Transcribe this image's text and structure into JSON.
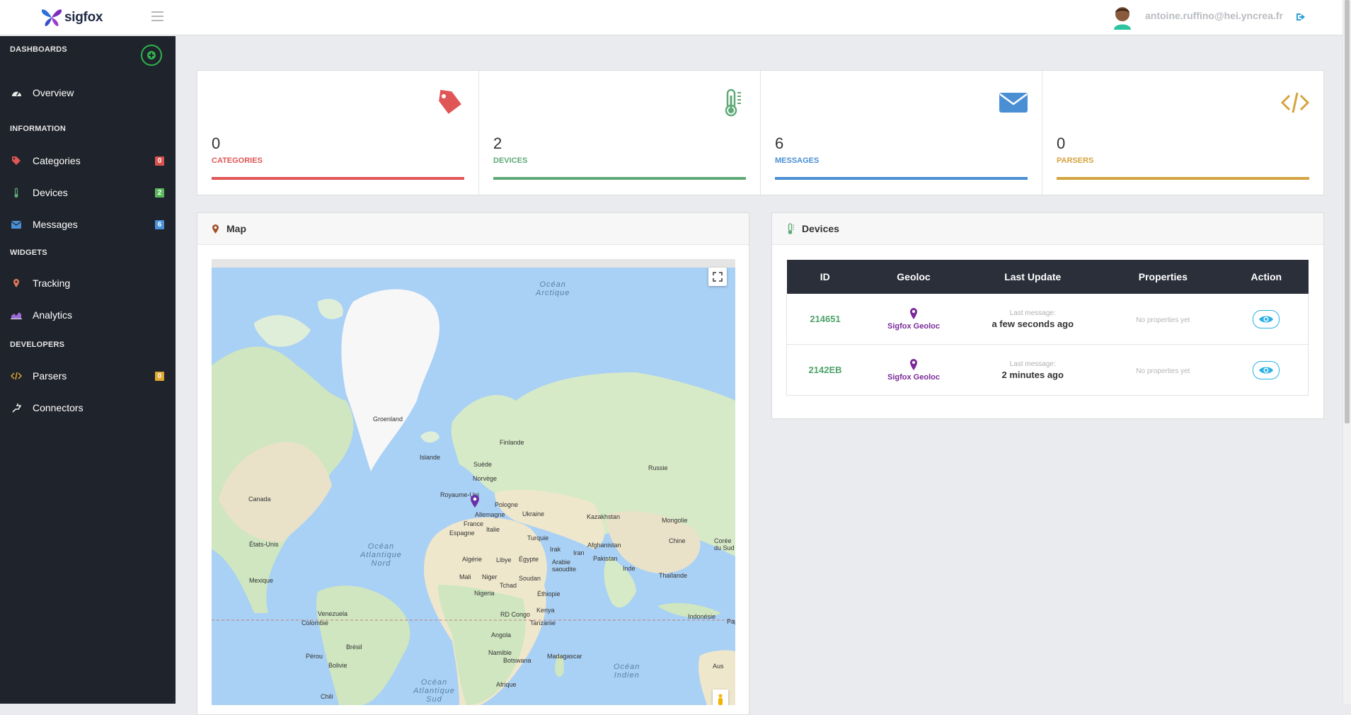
{
  "header": {
    "logo_text": "sigfox",
    "user_email": "antoine.ruffino@hei.yncrea.fr"
  },
  "sidebar": {
    "sections": {
      "dashboards": "DASHBOARDS",
      "information": "INFORMATION",
      "widgets": "WIDGETS",
      "developers": "DEVELOPERS"
    },
    "items": {
      "overview": {
        "label": "Overview",
        "icon": "dashboard-icon"
      },
      "categories": {
        "label": "Categories",
        "icon": "tag-icon",
        "badge": "0",
        "badge_color": "#d9534f"
      },
      "devices": {
        "label": "Devices",
        "icon": "thermometer-icon",
        "badge": "2",
        "badge_color": "#5cb85c"
      },
      "messages": {
        "label": "Messages",
        "icon": "envelope-icon",
        "badge": "6",
        "badge_color": "#4a90d9"
      },
      "tracking": {
        "label": "Tracking",
        "icon": "map-marker-icon"
      },
      "analytics": {
        "label": "Analytics",
        "icon": "area-chart-icon"
      },
      "parsers": {
        "label": "Parsers",
        "icon": "code-icon",
        "badge": "0",
        "badge_color": "#e0a82e"
      },
      "connectors": {
        "label": "Connectors",
        "icon": "plug-icon"
      }
    }
  },
  "stats": [
    {
      "value": "0",
      "label": "CATEGORIES",
      "color": "#e05656",
      "icon": "tag-icon"
    },
    {
      "value": "2",
      "label": "DEVICES",
      "color": "#5fa977",
      "icon": "thermometer-icon"
    },
    {
      "value": "6",
      "label": "MESSAGES",
      "color": "#4a8fd4",
      "icon": "envelope-icon"
    },
    {
      "value": "0",
      "label": "PARSERS",
      "color": "#d4a440",
      "icon": "code-icon"
    }
  ],
  "map_panel": {
    "title": "Map",
    "labels": {
      "ocean_arctic": "Océan\nArctique",
      "ocean_atl_nord": "Océan\nAtlantique\nNord",
      "ocean_atl_sud": "Océan\nAtlantique\nSud",
      "ocean_indien": "Océan\nIndien",
      "groenland": "Groenland",
      "islande": "Islande",
      "canada": "Canada",
      "etats_unis": "États-Unis",
      "mexique": "Mexique",
      "venezuela": "Venezuela",
      "colombie": "Colombie",
      "bresil": "Brésil",
      "perou": "Pérou",
      "bolivie": "Bolivie",
      "chili": "Chili",
      "norvege": "Norvège",
      "suede": "Suède",
      "finlande": "Finlande",
      "royaume_uni": "Royaume-Uni",
      "allemagne": "Allemagne",
      "pologne": "Pologne",
      "ukraine": "Ukraine",
      "france": "France",
      "espagne": "Espagne",
      "italie": "Italie",
      "turquie": "Turquie",
      "russie": "Russie",
      "kazakhstan": "Kazakhstan",
      "mongolie": "Mongolie",
      "chine": "Chine",
      "coree": "Corée\ndu Sud",
      "irak": "Irak",
      "iran": "Iran",
      "afghanistan": "Afghanistan",
      "pakistan": "Pakistan",
      "inde": "Inde",
      "thailande": "Thaïlande",
      "indonesie": "Indonésie",
      "algerie": "Algérie",
      "libye": "Libye",
      "egypte": "Égypte",
      "arabie": "Arabie\nsaoudite",
      "mali": "Mali",
      "niger": "Niger",
      "tchad": "Tchad",
      "soudan": "Soudan",
      "nigeria": "Nigeria",
      "ethiopie": "Éthiopie",
      "rdcongo": "RD Congo",
      "kenya": "Kenya",
      "tanzanie": "Tanzanie",
      "angola": "Angola",
      "namibie": "Namibie",
      "botswana": "Botswana",
      "madagascar": "Madagascar",
      "afrique": "Afrique",
      "aus": "Aus",
      "pap": "Pap"
    }
  },
  "devices_panel": {
    "title": "Devices",
    "columns": [
      "ID",
      "Geoloc",
      "Last Update",
      "Properties",
      "Action"
    ],
    "rows": [
      {
        "id": "214651",
        "geoloc": "Sigfox Geoloc",
        "last_label": "Last message:",
        "last_value": "a few seconds ago",
        "properties": "No properties yet"
      },
      {
        "id": "2142EB",
        "geoloc": "Sigfox Geoloc",
        "last_label": "Last message:",
        "last_value": "2 minutes ago",
        "properties": "No properties yet"
      }
    ]
  }
}
